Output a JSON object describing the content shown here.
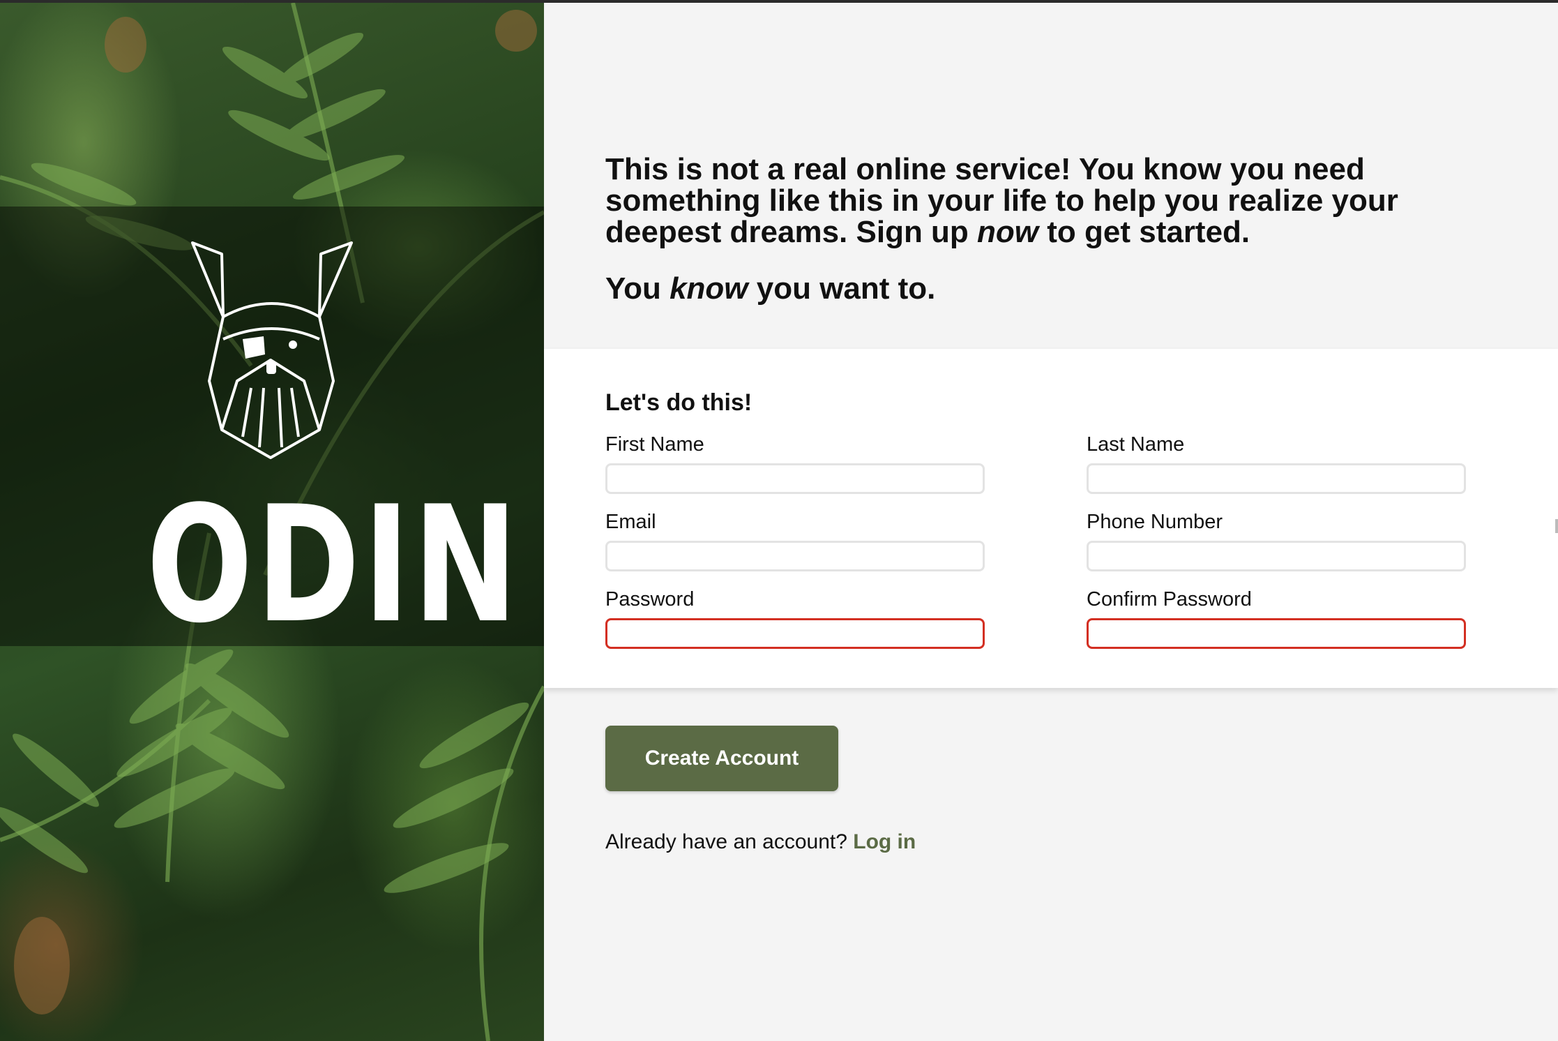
{
  "brand": {
    "name": "ODIN",
    "icon": "viking-helmet-icon"
  },
  "intro": {
    "line1_before": "This is not a real online service! You know you need something like this in your life to help you realize your deepest dreams. Sign up ",
    "line1_em": "now",
    "line1_after": " to get started.",
    "line2_before": "You ",
    "line2_em": "know",
    "line2_after": " you want to."
  },
  "form": {
    "title": "Let's do this!",
    "fields": {
      "first_name": {
        "label": "First Name",
        "value": ""
      },
      "last_name": {
        "label": "Last Name",
        "value": ""
      },
      "email": {
        "label": "Email",
        "value": ""
      },
      "phone": {
        "label": "Phone Number",
        "value": ""
      },
      "password": {
        "label": "Password",
        "value": ""
      },
      "confirm_password": {
        "label": "Confirm Password",
        "value": ""
      }
    }
  },
  "actions": {
    "submit_label": "Create Account",
    "login_prompt": "Already have an account?",
    "login_link": "Log in"
  },
  "colors": {
    "accent": "#5b6b45",
    "error_border": "#d32f22",
    "panel_bg": "#ffffff",
    "page_bg": "#f4f4f4"
  }
}
